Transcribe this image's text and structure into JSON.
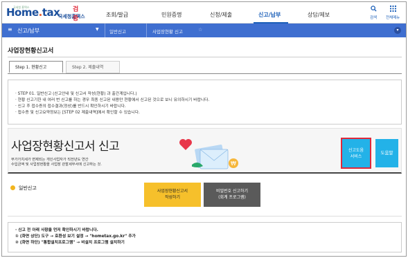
{
  "header": {
    "logo_tagline": "국세청 홈택스",
    "logo_brand": "Hometax",
    "logo_subtitle": "국세청홈택스",
    "logo_badge": "검증",
    "menu": [
      {
        "label": "조회/발급",
        "active": false
      },
      {
        "label": "민원증명",
        "active": false
      },
      {
        "label": "신청/제출",
        "active": false
      },
      {
        "label": "신고/납부",
        "active": true
      },
      {
        "label": "상담/제보",
        "active": false
      }
    ],
    "search_label": "검색",
    "all_menu_label": "전체메뉴",
    "accent_color": "#1b5fb8"
  },
  "navbar": {
    "section": "신고/납부",
    "crumb1": "일반신고",
    "crumb2": "사업장현황 신고",
    "color": "#3f6fd0"
  },
  "page": {
    "title": "사업장현황신고서",
    "tabs": [
      {
        "label": "Step 1. 현황신고",
        "active": true
      },
      {
        "label": "Step 2. 제출내역",
        "active": false
      }
    ]
  },
  "notice": {
    "lines": [
      "· STEP 01. 일반신고 (신고안내 및 신고서 작성(현황) 과 출간계입니다.)",
      "· 현황 신고기한 내 여러 번 신고를 하는 경우 최종 신고된 내용만 현황에서 신고된 것으로 보니 유의하시기 바랍니다.",
      "· 신고 후 접수증의 접수결과(정상)를 반드시 확인하시기 바랍니다.",
      "· 접수증 및 신고요약정보는 [STEP 02 제출내역]에서 확인할 수 있습니다."
    ]
  },
  "hero": {
    "title": "사업장현황신고서 신고",
    "desc_line1": "부가가치세가 면제되는 개인사업자가 직전년도 연간",
    "desc_line2": "수입금액 및 사업장현황을 사업장 관할세무서에 신고하는 것.",
    "guide_button": "신고도움\n서비스",
    "help_button": "도움말"
  },
  "general": {
    "label": "일반신고",
    "write_button": "사업장현황신고서\n작성하기",
    "install_button": "비밀번호 신고하기\n(회계 프로그램)"
  },
  "note": {
    "lines": [
      "· 신고 전 아래 사항을 먼저 확인하시기 바랍니다.",
      "① (화면 상단) 도구 → 호환성 보기 설정 → \"hometax.go.kr\" 추가",
      "② (화면 하단) \"통합설치프로그램\" → 비설치 프로그램 설치하기"
    ]
  }
}
